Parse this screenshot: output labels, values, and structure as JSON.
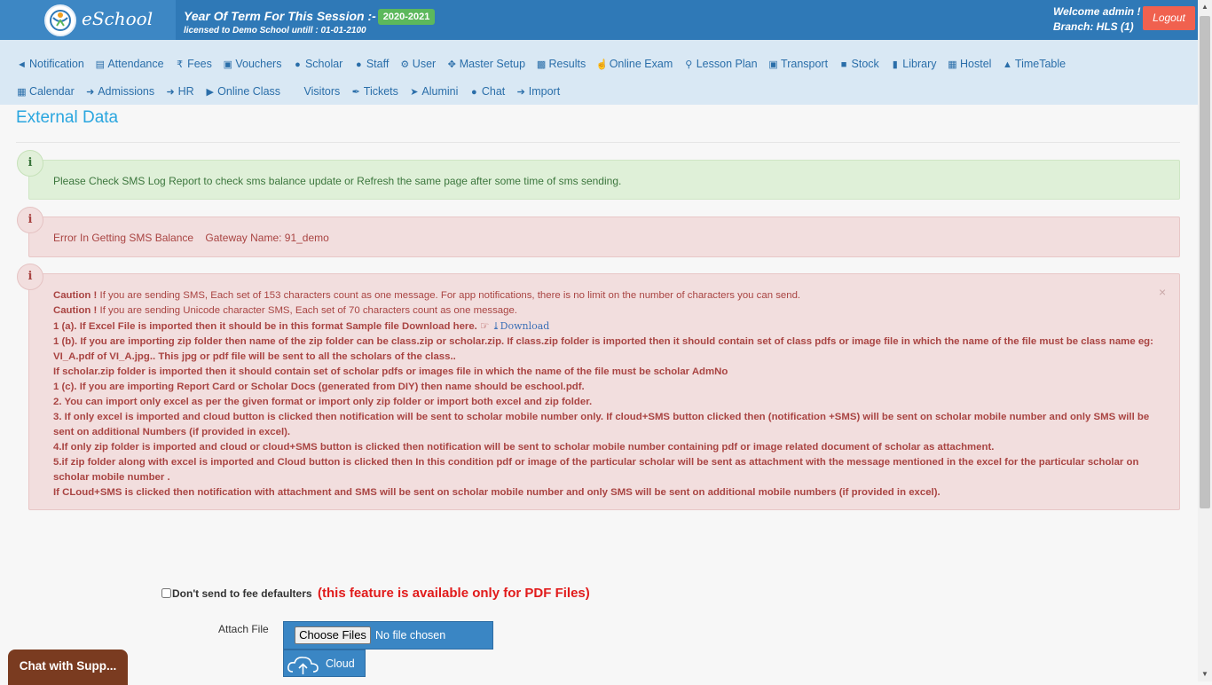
{
  "header": {
    "brand": "eSchool",
    "session_title": "Year Of Term For This Session :-",
    "session_value": "2020-2021",
    "license": "licensed to Demo School untill : 01-01-2100",
    "welcome": "Welcome admin !",
    "branch": "Branch: HLS (1)",
    "logout_label": "Logout"
  },
  "nav": {
    "row1": [
      {
        "label": "Notification",
        "icon": "bullhorn-icon"
      },
      {
        "label": "Attendance",
        "icon": "document-icon"
      },
      {
        "label": "Fees",
        "icon": "rupee-icon"
      },
      {
        "label": "Vouchers",
        "icon": "money-icon"
      },
      {
        "label": "Scholar",
        "icon": "users-icon"
      },
      {
        "label": "Staff",
        "icon": "user-icon"
      },
      {
        "label": "User",
        "icon": "wrench-icon"
      },
      {
        "label": "Master Setup",
        "icon": "arrows-icon"
      },
      {
        "label": "Results",
        "icon": "bar-chart-icon"
      },
      {
        "label": "Online Exam",
        "icon": "thumbs-up-icon"
      },
      {
        "label": "Lesson Plan",
        "icon": "lightbulb-icon"
      },
      {
        "label": "Transport",
        "icon": "bus-icon"
      },
      {
        "label": "Stock",
        "icon": "folder-icon"
      },
      {
        "label": "Library",
        "icon": "book-icon"
      },
      {
        "label": "Hostel",
        "icon": "building-icon"
      },
      {
        "label": "TimeTable",
        "icon": "bell-icon"
      }
    ],
    "row2": [
      {
        "label": "Calendar",
        "icon": "calendar-icon"
      },
      {
        "label": "Admissions",
        "icon": "sign-in-icon"
      },
      {
        "label": "HR",
        "icon": "sign-in-icon"
      },
      {
        "label": "Online Class",
        "icon": "play-icon"
      },
      {
        "label": "Visitors",
        "icon": ""
      },
      {
        "label": "Tickets",
        "icon": "tag-icon"
      },
      {
        "label": "Alumini",
        "icon": "send-icon"
      },
      {
        "label": "Chat",
        "icon": "comments-icon"
      },
      {
        "label": "Import",
        "icon": "arrow-right-icon"
      }
    ]
  },
  "page": {
    "title": "External Data"
  },
  "alerts": {
    "success_text": "Please Check SMS Log Report to check sms balance update or Refresh the same page after some time of sms sending.",
    "error_text": "Error In Getting SMS Balance",
    "gateway_text": "Gateway Name: 91_demo",
    "info_icon": "i",
    "close_symbol": "×"
  },
  "caution": {
    "l1_bold": "Caution !",
    "l1_text": " If you are sending SMS, Each set of 153 characters count as one message. For app notifications, there is no limit on the number of characters you can send.",
    "l2_bold": "Caution !",
    "l2_text": " If you are sending Unicode character SMS, Each set of 70 characters count as one message.",
    "l3": "1 (a). If Excel File is imported then it should be in this format Sample file Download here.",
    "download_label": "Download",
    "l4": "1 (b). If you are importing zip folder then name of the zip folder can be class.zip or scholar.zip. If class.zip folder is imported then it should contain set of class pdfs or image file in which the name of the file must be class name eg: VI_A.pdf of VI_A.jpg.. This jpg or pdf file will be sent to all the scholars of the class..",
    "l5": "If scholar.zip folder is imported then it should contain set of scholar pdfs or images file in which the name of the file must be scholar AdmNo",
    "l6": "1 (c). If you are importing Report Card or Scholar Docs (generated from DIY) then name should be eschool.pdf.",
    "l7": "2. You can import only excel as per the given format or import only zip folder or import both excel and zip folder.",
    "l8": "3. If only excel is imported and cloud button is clicked then notification will be sent to scholar mobile number only. If cloud+SMS button clicked then (notification +SMS) will be sent on scholar mobile number and only SMS will be sent on additional Numbers (if provided in excel).",
    "l9": "4.If only zip folder is imported and cloud or cloud+SMS button is clicked then notification will be sent to scholar mobile number containing pdf or image related document of scholar as attachment.",
    "l10": "5.if zip folder along with excel is imported and Cloud button is clicked then In this condition pdf or image of the particular scholar will be sent as attachment with the message mentioned in the excel for the particular scholar on scholar mobile number .",
    "l11": "If CLoud+SMS is clicked then notification with attachment and SMS will be sent on scholar mobile number and only SMS will be sent on additional mobile numbers (if provided in excel)."
  },
  "form": {
    "defaulter_label": "Don't send to fee defaulters",
    "pdf_note": "(this feature is available only for PDF Files)",
    "attach_label": "Attach File",
    "choose_files": "Choose Files",
    "no_file": "No file chosen",
    "cloud_label": "Cloud"
  },
  "chat_widget": {
    "label": "Chat with Supp..."
  },
  "colors": {
    "header": "#2f79b7",
    "nav_bg": "#d9e8f4",
    "accent": "#2aa6df",
    "logout": "#f0614f",
    "danger_text": "#a94442",
    "success_text": "#3c763d"
  }
}
